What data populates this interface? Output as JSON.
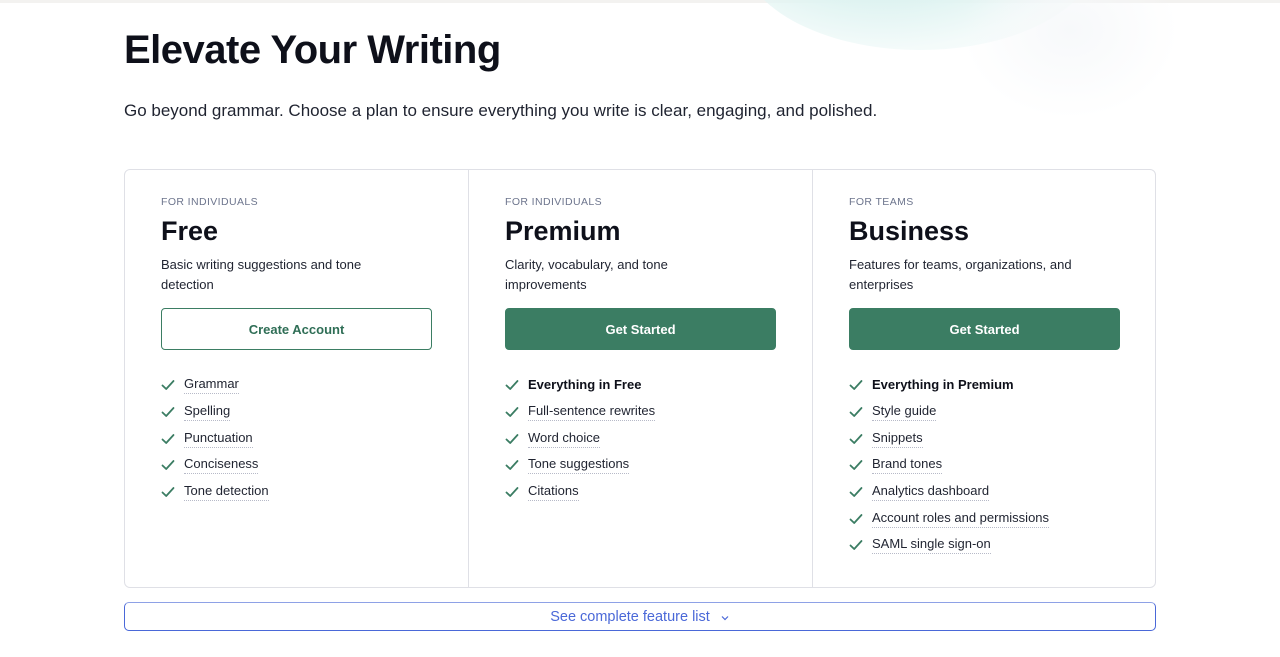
{
  "page": {
    "title": "Elevate Your Writing",
    "subtitle": "Go beyond grammar. Choose a plan to ensure everything you write is clear, engaging, and polished."
  },
  "colors": {
    "brand_green": "#3b7d63",
    "link_blue": "#4a68d8",
    "text_dark": "#0e101a"
  },
  "plans": [
    {
      "eyebrow": "FOR INDIVIDUALS",
      "name": "Free",
      "description": "Basic writing suggestions and tone detection",
      "cta": "Create Account",
      "features": [
        "Grammar",
        "Spelling",
        "Punctuation",
        "Conciseness",
        "Tone detection"
      ]
    },
    {
      "eyebrow": "FOR INDIVIDUALS",
      "name": "Premium",
      "description": "Clarity, vocabulary, and tone improvements",
      "cta": "Get Started",
      "features": [
        "Everything in Free",
        "Full-sentence rewrites",
        "Word choice",
        "Tone suggestions",
        "Citations"
      ]
    },
    {
      "eyebrow": "FOR TEAMS",
      "name": "Business",
      "description": "Features for teams, organizations, and enterprises",
      "cta": "Get Started",
      "features": [
        "Everything in Premium",
        "Style guide",
        "Snippets",
        "Brand tones",
        "Analytics dashboard",
        "Account roles and permissions",
        "SAML single sign-on"
      ]
    }
  ],
  "footer_toggle": {
    "label": "See complete feature list",
    "icon": "chevron-down-icon"
  }
}
